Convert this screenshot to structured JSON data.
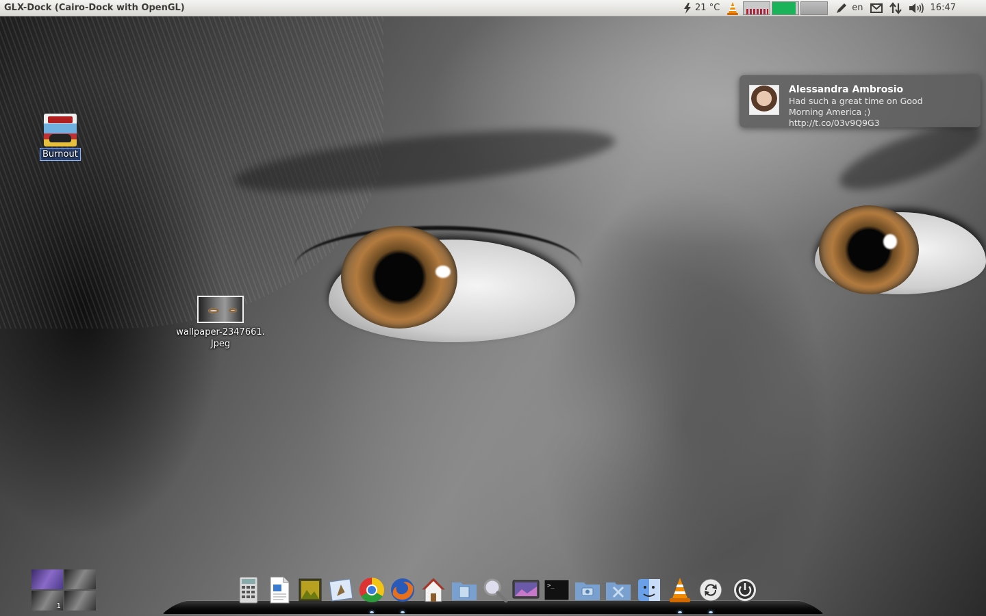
{
  "top_panel": {
    "app_title": "GLX-Dock (Cairo-Dock with OpenGL)",
    "weather": "21 °C",
    "memory_fill_percent": 90,
    "keyboard_layout": "en",
    "clock": "16:47"
  },
  "desktop": {
    "icons": [
      {
        "label": "Burnout"
      },
      {
        "label": "wallpaper-2347661.\nJpeg"
      }
    ]
  },
  "notification": {
    "title": "Alessandra Ambrosio",
    "body": "Had such a great time on Good Morning America ;) http://t.co/03v9Q9G3"
  },
  "workspace_switcher": {
    "workspace_number": "1"
  },
  "dock": {
    "items": [
      "calculator-icon",
      "document-icon",
      "image-viewer-icon",
      "mail-icon",
      "chrome-icon",
      "firefox-icon",
      "home-icon",
      "folder-icon",
      "search-icon",
      "screen-icon",
      "terminal-icon",
      "pictures-folder-icon",
      "tools-folder-icon",
      "finder-icon",
      "vlc-icon",
      "refresh-icon",
      "power-icon"
    ]
  },
  "colors": {
    "panel_bg": "#e5e4e0",
    "memory_graph": "#1ab35a",
    "vlc_orange": "#f08a00",
    "notification_bg": "#5f5f5f"
  }
}
